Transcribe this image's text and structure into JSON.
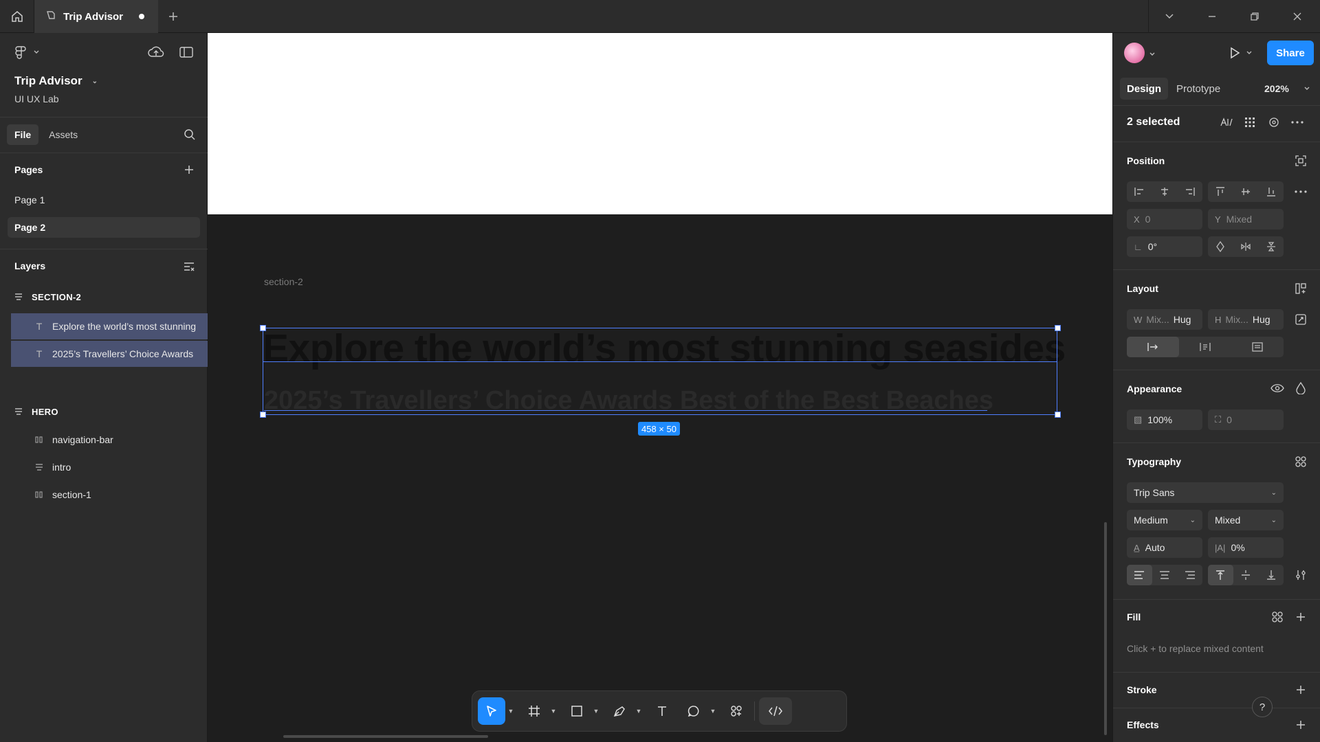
{
  "titlebar": {
    "tab_title": "Trip Advisor"
  },
  "left_panel": {
    "project_title": "Trip Advisor",
    "team": "UI UX Lab",
    "tabs": [
      "File",
      "Assets"
    ],
    "pages_heading": "Pages",
    "pages": [
      {
        "label": "Page 1",
        "active": false
      },
      {
        "label": "Page 2",
        "active": true
      }
    ],
    "layers_heading": "Layers",
    "layers": [
      {
        "label": "SECTION-2"
      },
      {
        "label": "Explore the world’s most stunning"
      },
      {
        "label": "2025’s Travellers’ Choice Awards"
      },
      {
        "label": "HERO"
      },
      {
        "label": "navigation-bar"
      },
      {
        "label": "intro"
      },
      {
        "label": "section-1"
      }
    ]
  },
  "canvas": {
    "section_label": "section-2",
    "headline": "Explore the world’s most stunning seasides",
    "subline": "2025’s Travellers’ Choice Awards Best of the Best Beaches",
    "dimension_badge": "458 × 50"
  },
  "right_panel": {
    "share_label": "Share",
    "tabs": [
      "Design",
      "Prototype"
    ],
    "zoom": "202%",
    "selection": "2 selected",
    "position": {
      "heading": "Position",
      "x_label": "X",
      "x_value": "0",
      "y_label": "Y",
      "y_value": "Mixed",
      "rotation": "0°"
    },
    "layout": {
      "heading": "Layout",
      "w_label": "W",
      "w_value": "Mix...",
      "w_mode": "Hug",
      "h_label": "H",
      "h_value": "Mix...",
      "h_mode": "Hug"
    },
    "appearance": {
      "heading": "Appearance",
      "opacity": "100%",
      "radius": "0"
    },
    "typography": {
      "heading": "Typography",
      "font": "Trip Sans",
      "weight": "Medium",
      "size": "Mixed",
      "line_height": "Auto",
      "letter_spacing": "0%"
    },
    "fill": {
      "heading": "Fill",
      "hint": "Click + to replace mixed content"
    },
    "stroke_heading": "Stroke",
    "effects_heading": "Effects",
    "help": "?"
  },
  "colors": {
    "accent": "#1f8bff",
    "selection": "#4f7fff",
    "selected_layer": "#4a5272"
  }
}
